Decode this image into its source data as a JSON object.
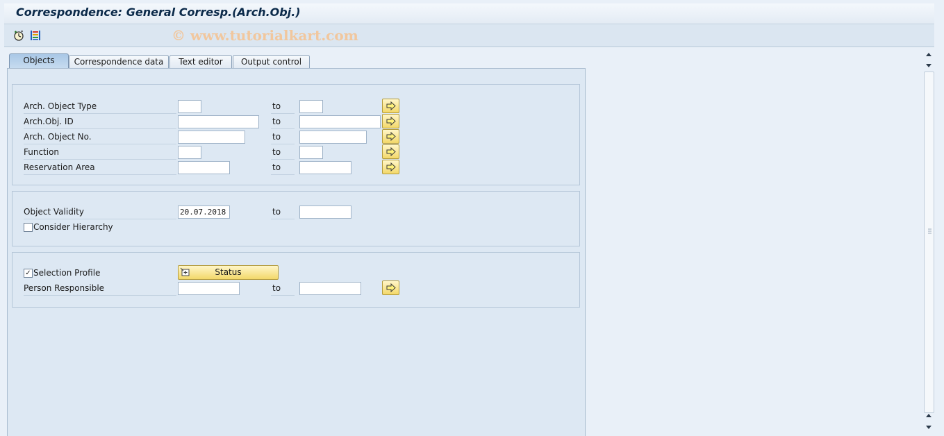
{
  "window": {
    "title": "Correspondence: General Corresp.(Arch.Obj.)",
    "watermark": "© www.tutorialkart.com"
  },
  "toolbar": {
    "icons": [
      "execute-icon",
      "selection-options-icon"
    ]
  },
  "tabs": [
    {
      "label": "Objects",
      "active": true
    },
    {
      "label": "Correspondence data",
      "active": false
    },
    {
      "label": "Text editor",
      "active": false
    },
    {
      "label": "Output control",
      "active": false
    }
  ],
  "groups": {
    "objects": {
      "rows": [
        {
          "label": "Arch. Object Type",
          "from": "",
          "to_label": "to",
          "to": ""
        },
        {
          "label": "Arch.Obj. ID",
          "from": "",
          "to_label": "to",
          "to": ""
        },
        {
          "label": "Arch. Object No.",
          "from": "",
          "to_label": "to",
          "to": ""
        },
        {
          "label": "Function",
          "from": "",
          "to_label": "to",
          "to": ""
        },
        {
          "label": "Reservation Area",
          "from": "",
          "to_label": "to",
          "to": ""
        }
      ]
    },
    "validity": {
      "label": "Object Validity",
      "from": "20.07.2018",
      "to_label": "to",
      "to": "",
      "hierarchy_label": "Consider Hierarchy",
      "hierarchy_checked": false
    },
    "profile": {
      "selection_profile_label": "Selection Profile",
      "selection_profile_checked": true,
      "check_mark": "✓",
      "status_button": "Status",
      "person_label": "Person Responsible",
      "person_from": "",
      "to_label": "to",
      "person_to": ""
    }
  },
  "colors": {
    "background": "#e9f0f8",
    "panel": "#dde8f3",
    "button_yellow": "#f3d86a",
    "title_text": "#0b2a4a"
  }
}
